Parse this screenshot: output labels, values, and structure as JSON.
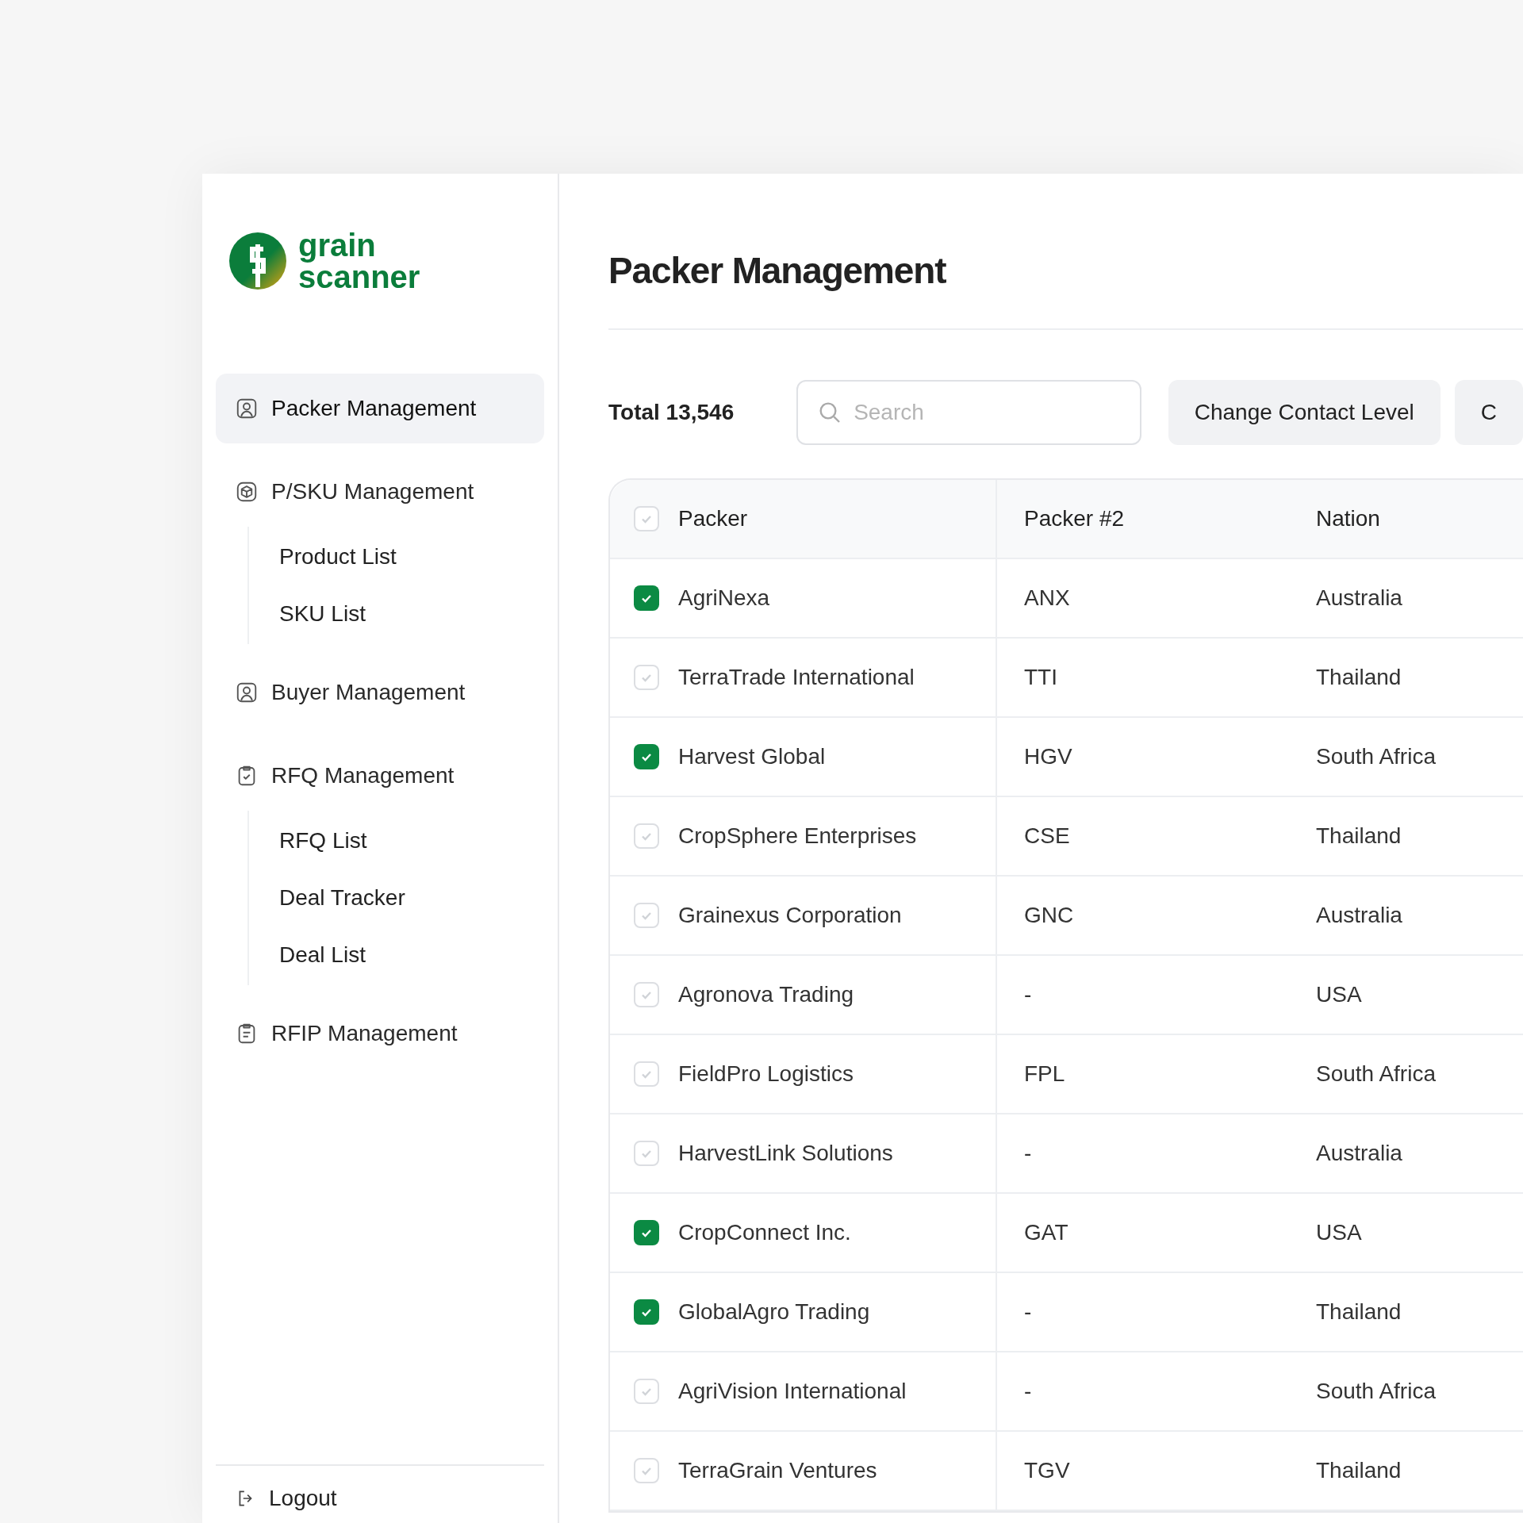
{
  "logo": {
    "line1": "grain",
    "line2": "scanner"
  },
  "sidebar": {
    "items": [
      {
        "label": "Packer Management",
        "kind": "person",
        "selected": true
      },
      {
        "label": "P/SKU Management",
        "kind": "box",
        "selected": false,
        "children": [
          {
            "label": "Product List",
            "selected": false
          },
          {
            "label": "SKU List",
            "selected": false
          }
        ]
      },
      {
        "label": "Buyer Management",
        "kind": "person",
        "selected": false
      },
      {
        "label": "RFQ Management",
        "kind": "clipboard-check",
        "selected": false,
        "children": [
          {
            "label": "RFQ List",
            "selected": false
          },
          {
            "label": "Deal Tracker",
            "selected": false
          },
          {
            "label": "Deal List",
            "selected": false
          }
        ]
      },
      {
        "label": "RFIP Management",
        "kind": "clipboard-list",
        "selected": false
      }
    ],
    "logout": "Logout"
  },
  "header": {
    "title": "Packer Management"
  },
  "toolbar": {
    "total": "Total 13,546",
    "search": {
      "placeholder": "Search"
    },
    "buttons": [
      "Change Contact Level",
      "C"
    ]
  },
  "table": {
    "columns": [
      "Packer",
      "Packer #2",
      "Nation"
    ],
    "header_checked": false,
    "rows": [
      {
        "checked": true,
        "cells": [
          "AgriNexa",
          "ANX",
          "Australia"
        ]
      },
      {
        "checked": false,
        "cells": [
          "TerraTrade International",
          "TTI",
          "Thailand"
        ]
      },
      {
        "checked": true,
        "cells": [
          "Harvest Global",
          "HGV",
          "South Africa"
        ]
      },
      {
        "checked": false,
        "cells": [
          "CropSphere Enterprises",
          "CSE",
          "Thailand"
        ]
      },
      {
        "checked": false,
        "cells": [
          "Grainexus Corporation",
          "GNC",
          "Australia"
        ]
      },
      {
        "checked": false,
        "cells": [
          "Agronova Trading",
          "-",
          "USA"
        ]
      },
      {
        "checked": false,
        "cells": [
          "FieldPro Logistics",
          "FPL",
          "South Africa"
        ]
      },
      {
        "checked": false,
        "cells": [
          "HarvestLink Solutions",
          "-",
          "Australia"
        ]
      },
      {
        "checked": true,
        "cells": [
          "CropConnect Inc.",
          "GAT",
          "USA"
        ]
      },
      {
        "checked": true,
        "cells": [
          "GlobalAgro Trading",
          "-",
          "Thailand"
        ]
      },
      {
        "checked": false,
        "cells": [
          "AgriVision International",
          "-",
          "South Africa"
        ]
      },
      {
        "checked": false,
        "cells": [
          "TerraGrain Ventures",
          "TGV",
          "Thailand"
        ]
      }
    ]
  }
}
